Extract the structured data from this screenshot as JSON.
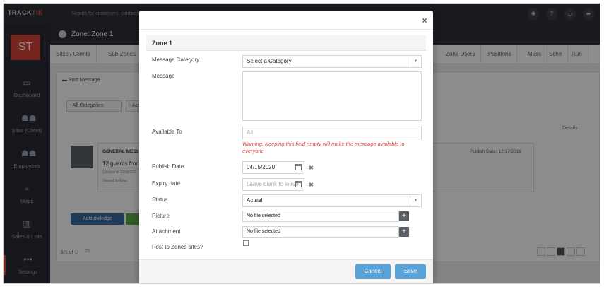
{
  "app": {
    "logo_track": "TRACK",
    "logo_tik": "TIK",
    "search_placeholder": "Search for customers, contacts"
  },
  "topbar_icons": [
    "broadcast-icon",
    "help-icon",
    "monitor-icon",
    "share-icon"
  ],
  "sidebar": {
    "avatar": "ST",
    "items": [
      {
        "label": "Dashboard",
        "icon": "monitor-icon"
      },
      {
        "label": "Sites (Client)",
        "icon": "group-icon"
      },
      {
        "label": "Employees",
        "icon": "group-icon"
      },
      {
        "label": "Maps",
        "icon": "map-icon"
      },
      {
        "label": "Sales & Lists",
        "icon": "bar-chart-icon"
      },
      {
        "label": "Settings",
        "icon": "dots-icon"
      }
    ]
  },
  "page": {
    "title": "Zone: Zone 1",
    "tabs": [
      "Sites / Clients",
      "Sub-Zones",
      "Zone Users",
      "Positions",
      "Mess",
      "Sche",
      "Run"
    ]
  },
  "background": {
    "post_message": "Post Message",
    "filter_category": "- All Categories",
    "filter_act": "- Act",
    "details": "Details",
    "card_title": "GENERAL MESSA",
    "card_body": "12 guards from",
    "card_created": "Created At 12/18/201",
    "card_viewed": "Viewed by Emp",
    "card_date": "Publish Date: 12/17/2019",
    "ack_button": "Acknowledge",
    "pager_count": "1/1 of 1",
    "pager_size": "25"
  },
  "modal": {
    "section_title": "Zone 1",
    "close": "×",
    "fields": {
      "message_category": {
        "label": "Message Category",
        "value": "Select a Category"
      },
      "message": {
        "label": "Message",
        "value": ""
      },
      "available_to": {
        "label": "Available To",
        "placeholder": "All"
      },
      "warning": "Warning: Keeping this field empty will make the message available to everyone",
      "publish_date": {
        "label": "Publish Date",
        "value": "04/15/2020"
      },
      "expiry_date": {
        "label": "Expiry date",
        "placeholder": "Leave blank to leave"
      },
      "status": {
        "label": "Status",
        "value": "Actual"
      },
      "picture": {
        "label": "Picture",
        "value": "No file selected"
      },
      "attachment": {
        "label": "Attachment",
        "value": "No file selected"
      },
      "post_to_zones": {
        "label": "Post to Zones sites?",
        "checked": false
      }
    },
    "cancel": "Cancel",
    "save": "Save"
  },
  "colors": {
    "accent": "#5aa3d8",
    "warning": "#d9453a",
    "sidebar": "#2a2d35",
    "avatar": "#d9453a"
  }
}
